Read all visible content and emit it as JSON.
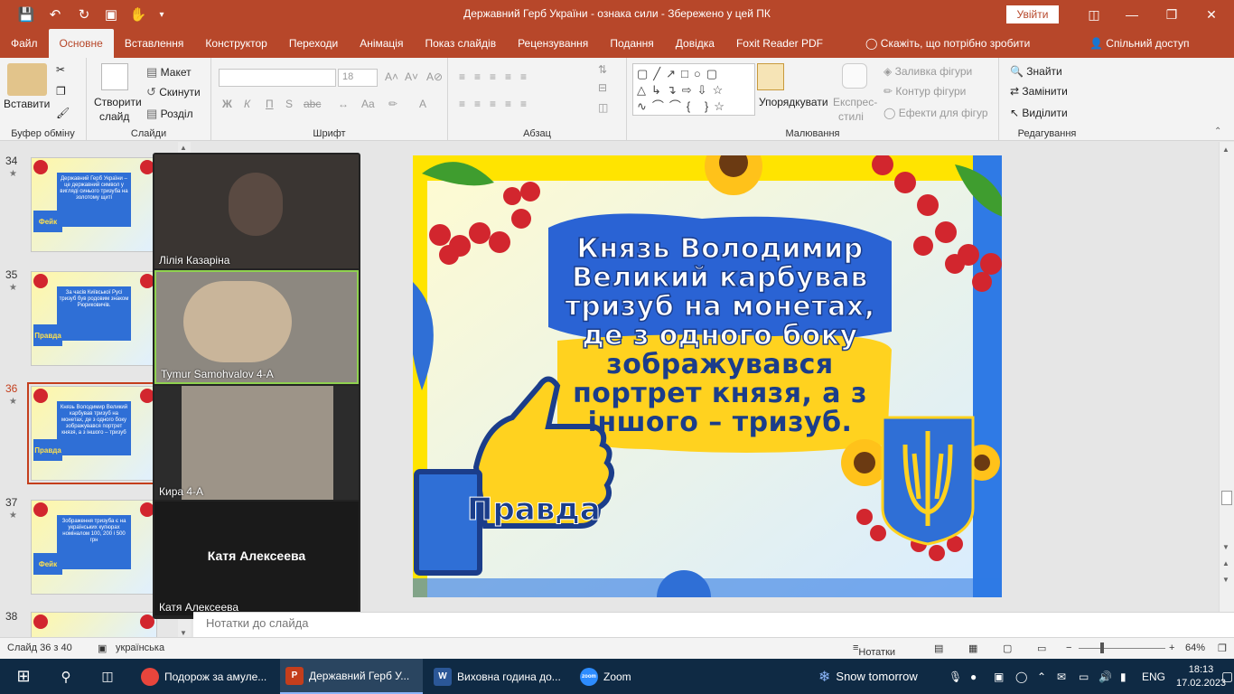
{
  "titlebar": {
    "title": "Державний Герб України - ознака сили  -  Збережено у цей ПК",
    "signin": "Увійти"
  },
  "tabs": [
    "Файл",
    "Основне",
    "Вставлення",
    "Конструктор",
    "Переходи",
    "Анімація",
    "Показ слайдів",
    "Рецензування",
    "Подання",
    "Довідка",
    "Foxit Reader PDF"
  ],
  "tell_me": "Скажіть, що потрібно зробити",
  "share": "Спільний доступ",
  "ribbon": {
    "paste": "Вставити",
    "clipboard_group": "Буфер обміну",
    "new_slide": "Створити",
    "new_slide2": "слайд",
    "layout": "Макет",
    "reset": "Скинути",
    "section": "Розділ",
    "slides_group": "Слайди",
    "font_size": "18",
    "font_group": "Шрифт",
    "paragraph_group": "Абзац",
    "arrange": "Упорядкувати",
    "quick_styles": "Експрес-",
    "quick_styles2": "стилі",
    "shape_fill": "Заливка фігури",
    "shape_outline": "Контур фігури",
    "shape_effects": "Ефекти для фігур",
    "drawing_group": "Малювання",
    "find": "Знайти",
    "replace": "Замінити",
    "select": "Виділити",
    "editing_group": "Редагування",
    "bold": "Ж",
    "italic": "К",
    "underline": "П",
    "shadow": "S",
    "strike": "abc"
  },
  "thumbnails": [
    {
      "num": "34",
      "text": "Державний Герб України – це державний символ у вигляді синього тризуба на золотому щиті",
      "badge": "Фейк"
    },
    {
      "num": "35",
      "text": "За часів Київської Русі тризуб був родовим знаком Рюриковичів.",
      "badge": "Правда"
    },
    {
      "num": "36",
      "text": "Князь Володимир Великий карбував тризуб на монетах, де з одного боку зображувався портрет князя, а з іншого – тризуб",
      "badge": "Правда"
    },
    {
      "num": "37",
      "text": "Зображення тризуба є на українських купюрах номіналом 100, 200 і 500 грн",
      "badge": "Фейк"
    },
    {
      "num": "38",
      "text": "",
      "badge": ""
    }
  ],
  "participants": [
    {
      "name": "Лілія Казаріна"
    },
    {
      "name": "Tymur Samohvalov 4-А"
    },
    {
      "name": "Кира 4-А"
    },
    {
      "name": "Катя Алексеева",
      "center": "Катя Алексеева"
    }
  ],
  "slide": {
    "text_lines": [
      "Князь Володимир",
      "Великий  карбував",
      "тризуб на монетах,",
      "де з одного боку",
      "зображувався",
      "портрет князя, а з",
      "іншого – тризуб."
    ],
    "verdict": "Правда"
  },
  "notes_placeholder": "Нотатки до слайда",
  "status": {
    "slide_info": "Слайд 36 з 40",
    "language": "українська",
    "notes": "Нотатки",
    "zoom": "64%"
  },
  "taskbar": {
    "items": [
      {
        "label": "Подорож за амуле..."
      },
      {
        "label": "Державний Герб У..."
      },
      {
        "label": "Виховна година до..."
      },
      {
        "label": "Zoom"
      }
    ],
    "weather": "Snow tomorrow",
    "lang": "ENG",
    "time": "18:13",
    "date": "17.02.2023"
  },
  "colors": {
    "accent": "#b7472a",
    "slide_blue": "#2f6fd6",
    "slide_yellow": "#ffd21f"
  }
}
